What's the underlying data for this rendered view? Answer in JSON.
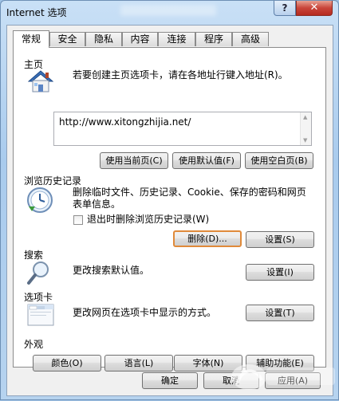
{
  "window": {
    "title": "Internet 选项",
    "help_label": "?",
    "close_label": "✕"
  },
  "tabs": [
    {
      "label": "常规",
      "active": true
    },
    {
      "label": "安全"
    },
    {
      "label": "隐私"
    },
    {
      "label": "内容"
    },
    {
      "label": "连接"
    },
    {
      "label": "程序"
    },
    {
      "label": "高级"
    }
  ],
  "homepage": {
    "title": "主页",
    "icon": "home-house-icon",
    "description": "若要创建主页选项卡，请在各地址行键入地址(R)。",
    "url": "http://www.xitongzhijia.net/",
    "buttons": {
      "use_current": "使用当前页(C)",
      "use_default": "使用默认值(F)",
      "use_blank": "使用空白页(B)"
    }
  },
  "history": {
    "title": "浏览历史记录",
    "icon": "clock-history-icon",
    "description_line1": "删除临时文件、历史记录、Cookie、保存的密码和网页",
    "description_line2": "表单信息。",
    "checkbox_label": "退出时删除浏览历史记录(W)",
    "checkbox_checked": false,
    "delete_label": "删除(D)...",
    "settings_label": "设置(S)"
  },
  "search": {
    "title": "搜索",
    "icon": "magnifier-icon",
    "description": "更改搜索默认值。",
    "settings_label": "设置(I)"
  },
  "tabsection": {
    "title": "选项卡",
    "icon": "tabbed-window-icon",
    "description": "更改网页在选项卡中显示的方式。",
    "settings_label": "设置(T)"
  },
  "appearance": {
    "title": "外观",
    "colors_label": "颜色(O)",
    "languages_label": "语言(L)",
    "fonts_label": "字体(N)",
    "accessibility_label": "辅助功能(E)"
  },
  "footer": {
    "ok_label": "确定",
    "cancel_label": "取消",
    "apply_label": "应用(A)"
  },
  "colors": {
    "focus_outline": "#e08a3a",
    "title_gradient_top": "#c9e0f6",
    "close_red": "#c9453a"
  }
}
